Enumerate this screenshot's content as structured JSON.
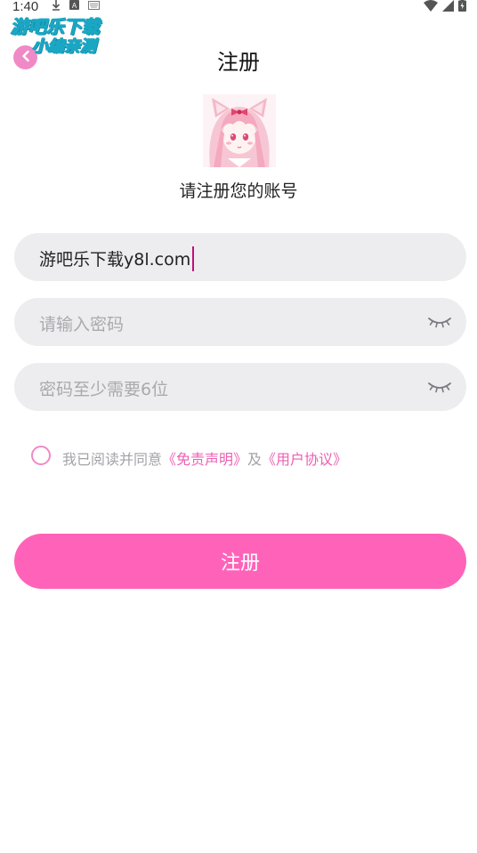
{
  "status_bar": {
    "time": "1:40",
    "icons": [
      "download-icon",
      "a-badge-icon",
      "keyboard-icon",
      "wifi-icon",
      "signal-icon",
      "battery-icon"
    ]
  },
  "watermark": {
    "line1": "游吧乐下载",
    "line2": "小编亲测"
  },
  "header": {
    "title": "注册",
    "back_icon": "chevron-left-icon"
  },
  "subtitle": "请注册您的账号",
  "form": {
    "account": {
      "value": "游吧乐下载y8l.com"
    },
    "password": {
      "placeholder": "请输入密码",
      "toggle_icon": "eye-closed-icon"
    },
    "confirm_password": {
      "placeholder": "密码至少需要6位",
      "toggle_icon": "eye-closed-icon"
    }
  },
  "agreement": {
    "checked": false,
    "prefix": "我已阅读并同意",
    "disclaimer_link": "《免责声明》",
    "conjunction": "及",
    "user_agreement_link": "《用户协议》"
  },
  "register_button": {
    "label": "注册"
  },
  "colors": {
    "accent": "#ff63b9",
    "link": "#ee5fb3",
    "field_bg": "#ededf0",
    "placeholder": "#a9a9ae"
  }
}
